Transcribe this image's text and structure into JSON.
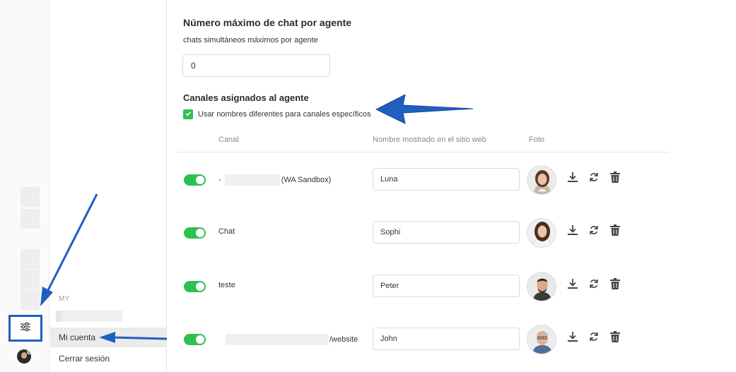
{
  "rail": {
    "icons": [
      "settings-sliders-icon",
      "user-avatar-icon"
    ]
  },
  "submenu": {
    "section_label": "MY",
    "items": [
      {
        "label": "Mi cuenta",
        "active": true
      },
      {
        "label": "Cerrar sesión",
        "active": false
      }
    ]
  },
  "settings": {
    "max_chats_title": "Número máximo de chat por agente",
    "max_chats_subtitle": "chats simultáneos máximos por agente",
    "max_chats_value": "0",
    "channels_title": "Canales asignados al agente",
    "different_names_label": "Usar nombres diferentes para canales específicos",
    "different_names_checked": true
  },
  "table": {
    "headers": {
      "channel": "Canal",
      "display_name": "Nombre mostrado en el sitio web",
      "photo": "Foto"
    },
    "rows": [
      {
        "enabled": true,
        "channel_prefix": "-",
        "channel": "(WA Sandbox)",
        "display_name": "Luna"
      },
      {
        "enabled": true,
        "channel_prefix": "",
        "channel": "Chat",
        "display_name": "Sophi"
      },
      {
        "enabled": true,
        "channel_prefix": "",
        "channel": "teste",
        "display_name": "Peter"
      },
      {
        "enabled": true,
        "channel_prefix": "",
        "channel": "/website",
        "display_name": "John"
      }
    ],
    "row_actions": [
      "download-icon",
      "refresh-icon",
      "trash-icon"
    ]
  },
  "colors": {
    "accent_green": "#2ec04f",
    "annotation_blue": "#1f5fbf"
  }
}
